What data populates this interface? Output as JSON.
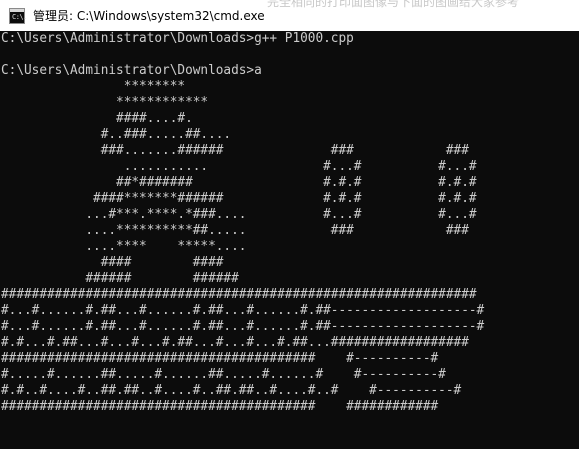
{
  "window": {
    "title": "管理员: C:\\Windows\\system32\\cmd.exe",
    "icon": "cmd-console-icon",
    "icon_glyph": "C:\\.",
    "behind_text": "完全相同的打印面图像与下面的图画给大家参考"
  },
  "console": {
    "background": "#0c0c0c",
    "foreground": "#cccccc",
    "lines": [
      "C:\\Users\\Administrator\\Downloads>g++ P1000.cpp",
      "",
      "C:\\Users\\Administrator\\Downloads>a",
      "                ********",
      "               ************",
      "               ####....#.",
      "             #..###.....##....",
      "             ###.......######              ###            ###",
      "                ...........               #...#          #...#",
      "               ##*#######                 #.#.#          #.#.#",
      "            ####*******######             #.#.#          #.#.#",
      "           ...#***.****.*###....          #...#          #...#",
      "           ....**********##.....           ###            ###",
      "           ....****    *****....",
      "             ####        ####",
      "           ######        ######",
      "##############################################################",
      "#...#......#.##...#......#.##...#......#.##-------------------#",
      "#...#......#.##...#......#.##...#......#.##-------------------#",
      "#.#...#.##...#...#...#.##...#...#...#.##...##################",
      "#########################################    #----------#",
      "#.....#......##.....#......##.....#......#    #----------#",
      "#.#..#....#..##.##..#....#..##.##..#....#..#    #----------#",
      "#########################################    ############"
    ]
  }
}
